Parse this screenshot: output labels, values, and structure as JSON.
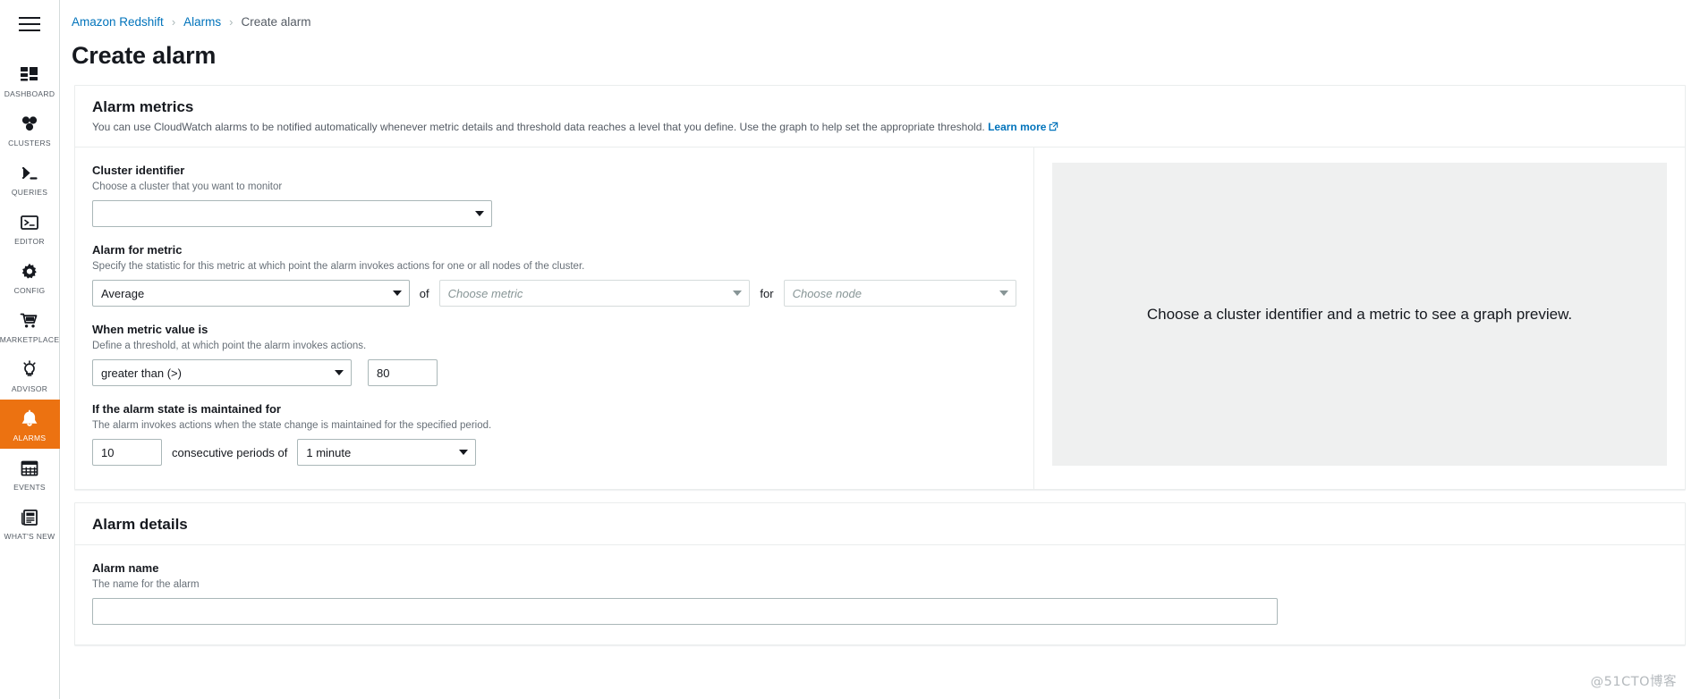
{
  "sidebar": {
    "menu_toggle": "menu-toggle",
    "items": [
      {
        "label": "DASHBOARD",
        "icon": "dashboard-icon",
        "active": false
      },
      {
        "label": "CLUSTERS",
        "icon": "clusters-icon",
        "active": false
      },
      {
        "label": "QUERIES",
        "icon": "queries-icon",
        "active": false
      },
      {
        "label": "EDITOR",
        "icon": "editor-icon",
        "active": false
      },
      {
        "label": "CONFIG",
        "icon": "gear-icon",
        "active": false
      },
      {
        "label": "MARKETPLACE",
        "icon": "shopping-cart-icon",
        "active": false
      },
      {
        "label": "ADVISOR",
        "icon": "lightbulb-icon",
        "active": false
      },
      {
        "label": "ALARMS",
        "icon": "bell-icon",
        "active": true
      },
      {
        "label": "EVENTS",
        "icon": "calendar-grid-icon",
        "active": false
      },
      {
        "label": "WHAT'S NEW",
        "icon": "newspaper-icon",
        "active": false
      }
    ],
    "active_color": "#ec7211"
  },
  "breadcrumb": {
    "items": [
      {
        "label": "Amazon Redshift",
        "link": true
      },
      {
        "label": "Alarms",
        "link": true
      },
      {
        "label": "Create alarm",
        "link": false
      }
    ],
    "separator": "›"
  },
  "page": {
    "title": "Create alarm"
  },
  "alarm_metrics": {
    "title": "Alarm metrics",
    "description": "You can use CloudWatch alarms to be notified automatically whenever metric details and threshold data reaches a level that you define. Use the graph to help set the appropriate threshold.",
    "learn_more": "Learn more",
    "cluster_identifier": {
      "label": "Cluster identifier",
      "hint": "Choose a cluster that you want to monitor",
      "value": "",
      "placeholder": ""
    },
    "alarm_for_metric": {
      "label": "Alarm for metric",
      "hint": "Specify the statistic for this metric at which point the alarm invokes actions for one or all nodes of the cluster.",
      "statistic_value": "Average",
      "of_text": "of",
      "metric_placeholder": "Choose metric",
      "for_text": "for",
      "node_placeholder": "Choose node"
    },
    "when_metric_value": {
      "label": "When metric value is",
      "hint": "Define a threshold, at which point the alarm invokes actions.",
      "comparison_value": "greater than (>)",
      "threshold_value": "80"
    },
    "maintained_for": {
      "label": "If the alarm state is maintained for",
      "hint": "The alarm invokes actions when the state change is maintained for the specified period.",
      "periods_value": "10",
      "middle_text": "consecutive periods of",
      "unit_value": "1 minute"
    },
    "graph_preview": {
      "message": "Choose a cluster identifier and a metric to see a graph preview."
    }
  },
  "alarm_details": {
    "title": "Alarm details",
    "alarm_name": {
      "label": "Alarm name",
      "hint": "The name for the alarm",
      "value": "",
      "placeholder": ""
    }
  },
  "watermark": {
    "text": "@51CTO博客"
  }
}
